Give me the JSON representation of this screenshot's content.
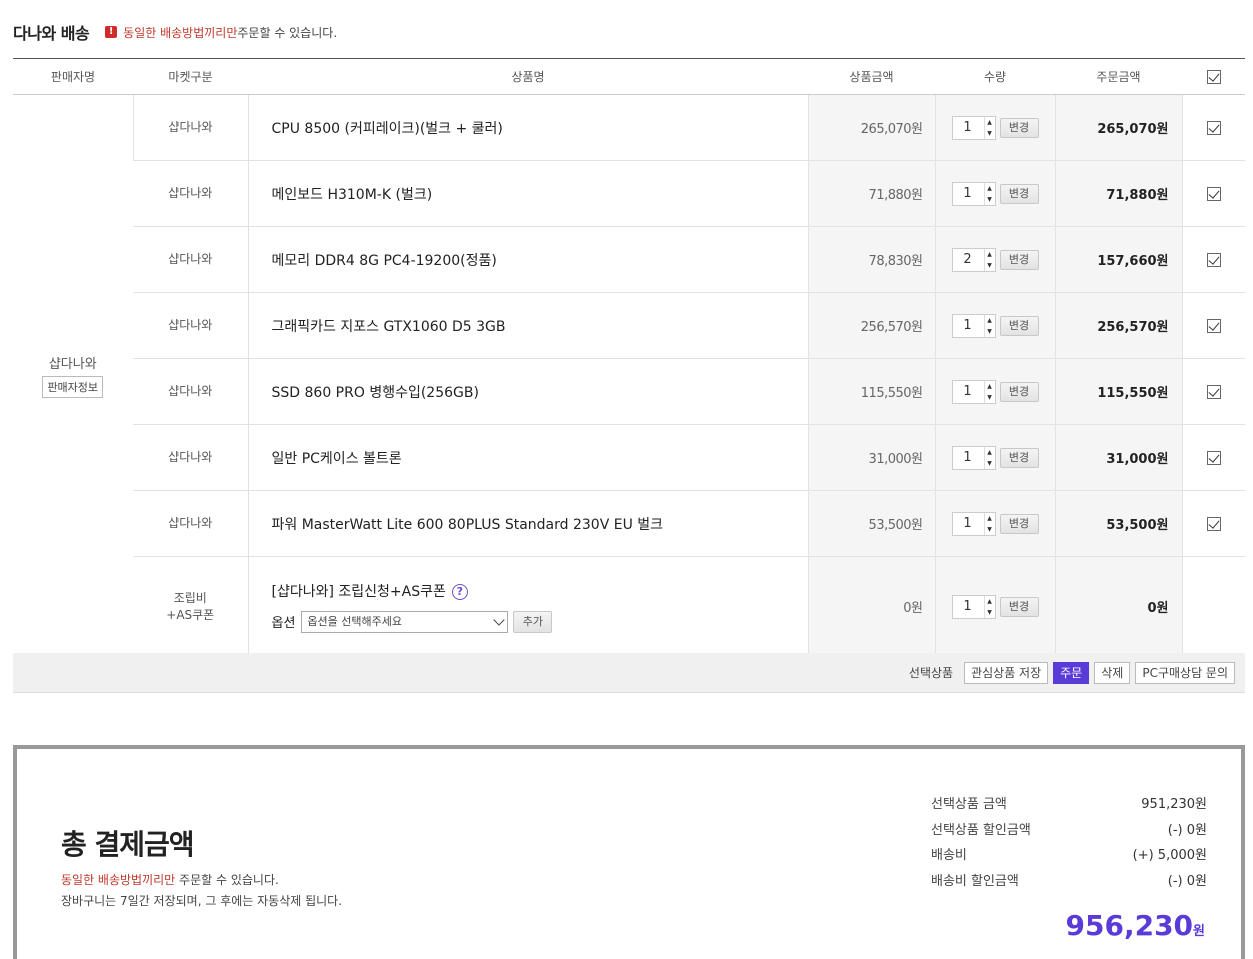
{
  "header": {
    "title": "다나와 배송",
    "warn_icon": "!",
    "warn_red": "동일한 배송방법끼리만",
    "warn_rest": " 주문할 수 있습니다."
  },
  "columns": {
    "seller": "판매자명",
    "market": "마켓구분",
    "product": "상품명",
    "price": "상품금액",
    "qty": "수량",
    "total": "주문금액"
  },
  "seller": {
    "name": "샵다나와",
    "info_button": "판매자정보"
  },
  "change_label": "변경",
  "rows": [
    {
      "market": "샵다나와",
      "name": "CPU 8500 (커피레이크)(벌크 + 쿨러)",
      "price": "265,070원",
      "qty": "1",
      "total": "265,070원"
    },
    {
      "market": "샵다나와",
      "name": "메인보드 H310M-K (벌크)",
      "price": "71,880원",
      "qty": "1",
      "total": "71,880원"
    },
    {
      "market": "샵다나와",
      "name": "메모리 DDR4 8G PC4-19200(정품)",
      "price": "78,830원",
      "qty": "2",
      "total": "157,660원"
    },
    {
      "market": "샵다나와",
      "name": "그래픽카드 지포스 GTX1060 D5 3GB",
      "price": "256,570원",
      "qty": "1",
      "total": "256,570원"
    },
    {
      "market": "샵다나와",
      "name": "SSD 860 PRO 병행수입(256GB)",
      "price": "115,550원",
      "qty": "1",
      "total": "115,550원"
    },
    {
      "market": "샵다나와",
      "name": "일반 PC케이스 볼트론",
      "price": "31,000원",
      "qty": "1",
      "total": "31,000원"
    },
    {
      "market": "샵다나와",
      "name": "파워 MasterWatt Lite 600 80PLUS Standard 230V EU 벌크",
      "price": "53,500원",
      "qty": "1",
      "total": "53,500원"
    }
  ],
  "assembly": {
    "market_line1": "조립비",
    "market_line2": "+AS쿠폰",
    "name": "[샵다나와] 조립신청+AS쿠폰",
    "help": "?",
    "option_label": "옵션",
    "option_placeholder": "옵션을 선택해주세요",
    "add_button": "추가",
    "price": "0원",
    "qty": "1",
    "total": "0원"
  },
  "actionbar": {
    "label": "선택상품",
    "wishlist": "관심상품 저장",
    "order": "주문",
    "delete": "삭제",
    "consult": "PC구매상담 문의"
  },
  "summary": {
    "title": "총 결제금액",
    "note1_red": "동일한 배송방법끼리만",
    "note1_rest": " 주문할 수 있습니다.",
    "note2": "장바구니는 7일간 저장되며, 그 후에는 자동삭제 됩니다.",
    "items": [
      {
        "label": "선택상품 금액",
        "value": "951,230원"
      },
      {
        "label": "선택상품 할인금액",
        "value": "(-) 0원"
      },
      {
        "label": "배송비",
        "value": "(+) 5,000원"
      },
      {
        "label": "배송비 할인금액",
        "value": "(-) 0원"
      }
    ],
    "grand_total": "956,230",
    "grand_unit": "원"
  },
  "colors": {
    "accent": "#5b3bd8",
    "warning": "#c0392b"
  }
}
